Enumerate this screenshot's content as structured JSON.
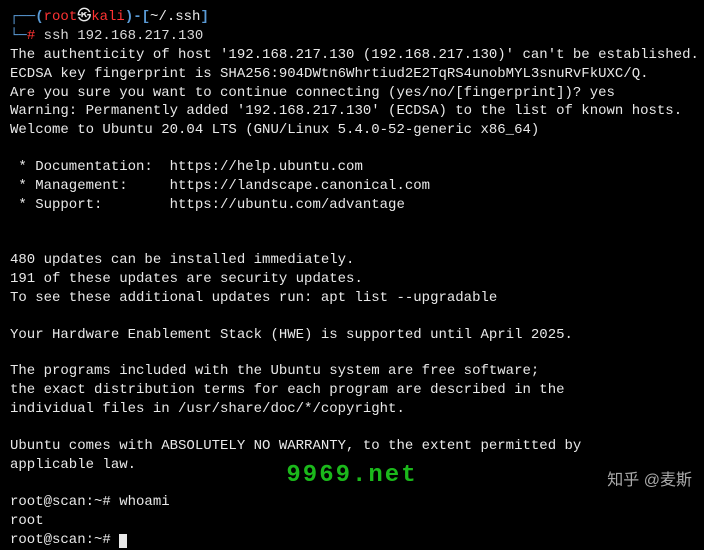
{
  "prompt_top": {
    "p1_open": "┌──(",
    "user": "root",
    "at": "㉿",
    "host": "kali",
    "p1_close": ")-[",
    "cwd": "~/.ssh",
    "p1_end": "]",
    "p2_open": "└─",
    "hash": "# ",
    "cmd": "ssh 192.168.217.130"
  },
  "lines": {
    "l1": "The authenticity of host '192.168.217.130 (192.168.217.130)' can't be established.",
    "l2": "ECDSA key fingerprint is SHA256:904DWtn6Whrtiud2E2TqRS4unobMYL3snuRvFkUXC/Q.",
    "l3": "Are you sure you want to continue connecting (yes/no/[fingerprint])? yes",
    "l4": "Warning: Permanently added '192.168.217.130' (ECDSA) to the list of known hosts.",
    "l5": "Welcome to Ubuntu 20.04 LTS (GNU/Linux 5.4.0-52-generic x86_64)",
    "l6": " * Documentation:  https://help.ubuntu.com",
    "l7": " * Management:     https://landscape.canonical.com",
    "l8": " * Support:        https://ubuntu.com/advantage",
    "l9": "480 updates can be installed immediately.",
    "l10": "191 of these updates are security updates.",
    "l11": "To see these additional updates run: apt list --upgradable",
    "l12": "Your Hardware Enablement Stack (HWE) is supported until April 2025.",
    "l13": "The programs included with the Ubuntu system are free software;",
    "l14": "the exact distribution terms for each program are described in the",
    "l15": "individual files in /usr/share/doc/*/copyright.",
    "l16": "Ubuntu comes with ABSOLUTELY NO WARRANTY, to the extent permitted by",
    "l17": "applicable law."
  },
  "shell": {
    "prompt1": "root@scan:~# ",
    "cmd1": "whoami",
    "out1": "root",
    "prompt2": "root@scan:~# "
  },
  "watermark": {
    "green": "9969.net",
    "zhihu": "知乎 @麦斯"
  }
}
